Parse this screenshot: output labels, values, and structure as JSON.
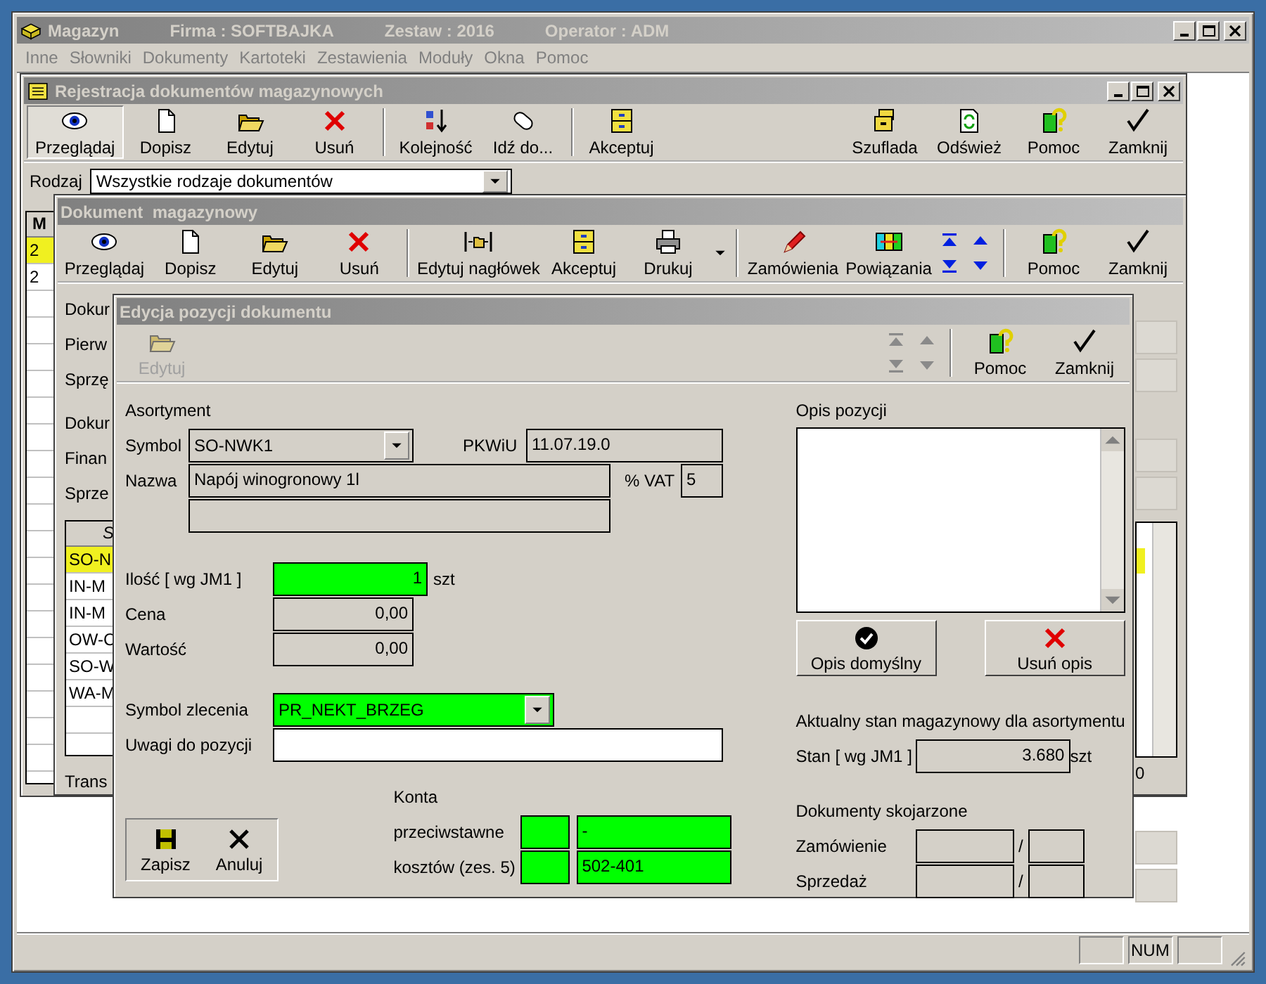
{
  "app": {
    "title": "Magazyn",
    "company": "Firma : SOFTBAJKA",
    "set": "Zestaw : 2016",
    "operator": "Operator : ADM"
  },
  "menu": [
    "Inne",
    "Słowniki",
    "Dokumenty",
    "Kartoteki",
    "Zestawienia",
    "Moduły",
    "Okna",
    "Pomoc"
  ],
  "registry": {
    "title": "Rejestracja dokumentów magazynowych",
    "toolbar_left": [
      [
        {
          "label": "Przeglądaj",
          "kind": "eye",
          "selected": true
        },
        {
          "label": "Dopisz",
          "kind": "page",
          "selected": false
        },
        {
          "label": "Edytuj",
          "kind": "folder",
          "selected": false
        },
        {
          "label": "Usuń",
          "kind": "cross",
          "selected": false
        }
      ],
      [
        {
          "label": "Kolejność",
          "kind": "sort",
          "selected": false
        },
        {
          "label": "Idź do...",
          "kind": "tag",
          "selected": false
        }
      ],
      [
        {
          "label": "Akceptuj",
          "kind": "cabinet",
          "selected": false
        }
      ]
    ],
    "toolbar_right": [
      {
        "label": "Szuflada",
        "kind": "drawer",
        "selected": false
      },
      {
        "label": "Odśwież",
        "kind": "refresh",
        "selected": false
      },
      {
        "label": "Pomoc",
        "kind": "help",
        "selected": false
      },
      {
        "label": "Zamknij",
        "kind": "check",
        "selected": false
      }
    ],
    "filter": {
      "label": "Rodzaj",
      "value": "Wszystkie rodzaje dokumentów"
    },
    "table": {
      "column_1": "M",
      "rows": [
        {
          "cell": "2",
          "selected": true
        },
        {
          "cell": "2",
          "selected": false
        }
      ]
    }
  },
  "document": {
    "title": "Dokument  magazynowy",
    "toolbar_left": [
      [
        {
          "label": "Przeglądaj",
          "kind": "eye"
        },
        {
          "label": "Dopisz",
          "kind": "page"
        },
        {
          "label": "Edytuj",
          "kind": "folder"
        },
        {
          "label": "Usuń",
          "kind": "cross"
        }
      ],
      [
        {
          "label": "Edytuj nagłówek",
          "kind": "header"
        },
        {
          "label": "Akceptuj",
          "kind": "cabinet"
        },
        {
          "label": "Drukuj",
          "kind": "printer",
          "dropdown": true
        }
      ],
      [
        {
          "label": "Zamówienia",
          "kind": "pencil"
        },
        {
          "label": "Powiązania",
          "kind": "links"
        }
      ]
    ],
    "navigation": {
      "disabled": false
    },
    "toolbar_right": [
      {
        "label": "Pomoc",
        "kind": "help"
      },
      {
        "label": "Zamknij",
        "kind": "check"
      }
    ],
    "labels": [
      "Dokur",
      "Pierw",
      "Sprzę",
      "Dokur",
      "Finan",
      "Sprze"
    ],
    "positions": {
      "column_1": "S",
      "rows": [
        {
          "cell": "SO-N",
          "selected": true
        },
        {
          "cell": "IN-M",
          "selected": false
        },
        {
          "cell": "IN-M",
          "selected": false
        },
        {
          "cell": "OW-C",
          "selected": false
        },
        {
          "cell": "SO-W",
          "selected": false
        },
        {
          "cell": "WA-M",
          "selected": false
        }
      ]
    },
    "footer_label": "Trans",
    "footer_value": "0"
  },
  "edit": {
    "title": "Edycja pozycji dokumentu",
    "toolbar_left": [
      {
        "label": "Edytuj",
        "kind": "folder",
        "disabled": true
      }
    ],
    "navigation": {
      "disabled": true
    },
    "toolbar_right": [
      {
        "label": "Pomoc",
        "kind": "help",
        "disabled": false
      },
      {
        "label": "Zamknij",
        "kind": "check",
        "disabled": false
      }
    ],
    "assortment": {
      "heading": "Asortyment",
      "symbol": {
        "label": "Symbol",
        "value": "SO-NWK1"
      },
      "pkwiu": {
        "label": "PKWiU",
        "value": "11.07.19.0"
      },
      "name": {
        "label": "Nazwa",
        "value": "Napój winogronowy 1l"
      },
      "vat": {
        "label": "% VAT",
        "value": "5"
      }
    },
    "fields": [
      {
        "label": "Ilość [ wg JM1 ]",
        "value": "1",
        "unit": "szt",
        "highlighted": true
      },
      {
        "label": "Cena",
        "value": "0,00",
        "highlighted": false
      },
      {
        "label": "Wartość",
        "value": "0,00",
        "highlighted": false
      }
    ],
    "order": {
      "label": "Symbol zlecenia",
      "value": "PR_NEKT_BRZEG",
      "highlighted": true
    },
    "remarks": {
      "label": "Uwagi do pozycji"
    },
    "accounts": {
      "heading": "Konta",
      "rows": [
        {
          "label": "przeciwstawne",
          "value": "-",
          "highlighted": true
        },
        {
          "label": "kosztów (zes. 5)",
          "value": "502-401",
          "highlighted": true
        }
      ]
    },
    "actions": [
      {
        "label": "Zapisz",
        "kind": "disk"
      },
      {
        "label": "Anuluj",
        "kind": "xblack"
      }
    ],
    "description": {
      "heading": "Opis pozycji",
      "buttons": [
        {
          "label": "Opis domyślny",
          "kind": "checkcircle"
        },
        {
          "label": "Usuń opis",
          "kind": "cross"
        }
      ]
    },
    "stock": {
      "heading": "Aktualny stan magazynowy dla asortymentu",
      "label": "Stan [ wg JM1 ]",
      "value": "3.680",
      "unit": "szt"
    },
    "linked": {
      "heading": "Dokumenty skojarzone",
      "rows": [
        {
          "label": "Zamówienie",
          "separator": "/"
        },
        {
          "label": "Sprzedaż",
          "separator": "/"
        }
      ]
    }
  },
  "status_bar": {
    "num_indicator": "NUM"
  }
}
